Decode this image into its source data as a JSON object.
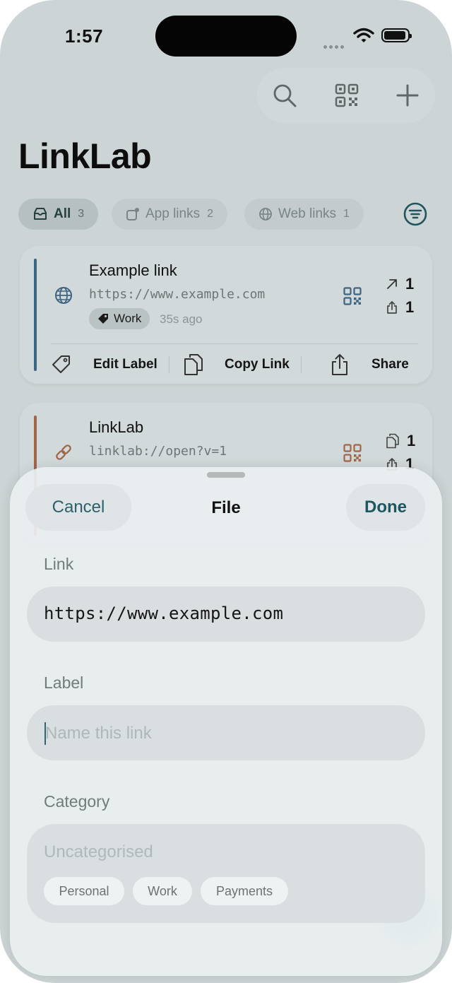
{
  "status_bar": {
    "time": "1:57"
  },
  "app": {
    "title": "LinkLab"
  },
  "filters": [
    {
      "label": "All",
      "count": "3",
      "icon": "tray-icon",
      "selected": true
    },
    {
      "label": "App links",
      "count": "2",
      "icon": "app-badge-icon",
      "selected": false
    },
    {
      "label": "Web links",
      "count": "1",
      "icon": "globe-icon",
      "selected": false
    }
  ],
  "cards": [
    {
      "name": "Example link",
      "url": "https://www.example.com",
      "tag": "Work",
      "time_ago": "35s ago",
      "stat_opened": "1",
      "stat_shared": "1",
      "actions": {
        "edit_label": "Edit Label",
        "copy_link": "Copy Link",
        "share": "Share"
      },
      "accent_color": "#3d6480"
    },
    {
      "name": "LinkLab",
      "url": "linklab://open?v=1",
      "stat_copied": "1",
      "stat_shared": "1",
      "accent_color": "#a0664a"
    }
  ],
  "sheet": {
    "title": "File",
    "cancel_label": "Cancel",
    "done_label": "Done",
    "link_label": "Link",
    "link_value": "https://www.example.com",
    "label_label": "Label",
    "label_placeholder": "Name this link",
    "category_label": "Category",
    "category_value": "Uncategorised",
    "categories": [
      "Personal",
      "Work",
      "Payments"
    ]
  },
  "colors": {
    "accent": "#1e5761",
    "web_accent": "#3d6480",
    "app_accent": "#a0664a"
  }
}
